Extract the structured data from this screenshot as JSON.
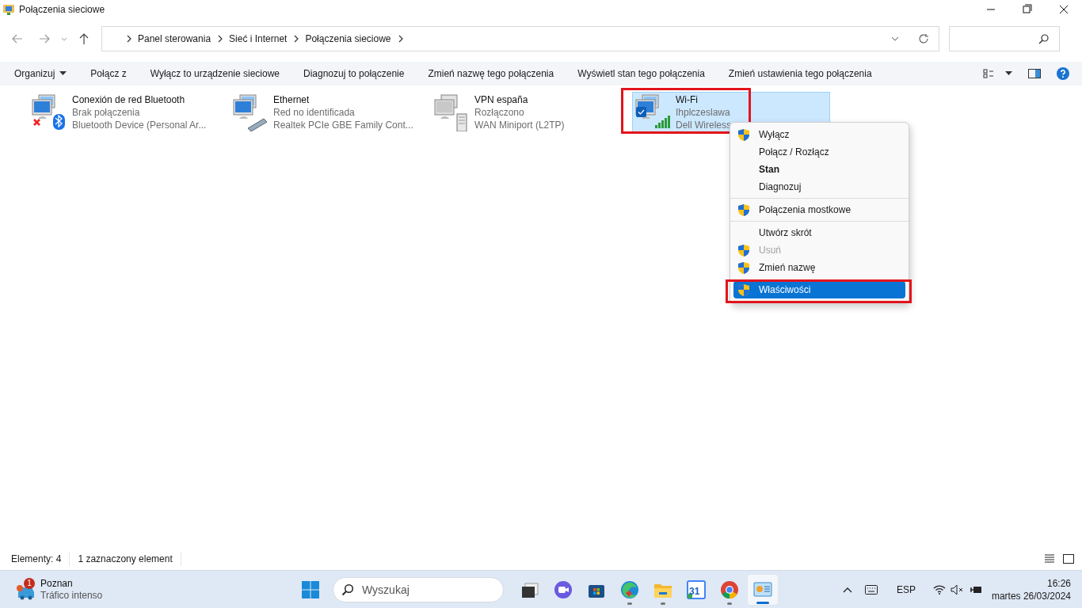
{
  "window": {
    "title": "Połączenia sieciowe"
  },
  "address": {
    "segments": [
      "Panel sterowania",
      "Sieć i Internet",
      "Połączenia sieciowe"
    ]
  },
  "toolbar": {
    "commands": [
      {
        "label": "Organizuj",
        "dropdown": true
      },
      {
        "label": "Połącz z",
        "dropdown": false
      },
      {
        "label": "Wyłącz to urządzenie sieciowe",
        "dropdown": false
      },
      {
        "label": "Diagnozuj to połączenie",
        "dropdown": false
      },
      {
        "label": "Zmień nazwę tego połączenia",
        "dropdown": false
      },
      {
        "label": "Wyświetl stan tego połączenia",
        "dropdown": false
      },
      {
        "label": "Zmień ustawienia tego połączenia",
        "dropdown": false
      }
    ]
  },
  "connections": [
    {
      "kind": "bluetooth",
      "name": "Conexión de red Bluetooth",
      "status": "Brak połączenia",
      "device": "Bluetooth Device (Personal Ar...",
      "selected": false
    },
    {
      "kind": "ethernet",
      "name": "Ethernet",
      "status": "Red no identificada",
      "device": "Realtek PCIe GBE Family Cont...",
      "selected": false
    },
    {
      "kind": "vpn",
      "name": "VPN españa",
      "status": "Rozłączono",
      "device": "WAN Miniport (L2TP)",
      "selected": false
    },
    {
      "kind": "wifi",
      "name": "Wi-Fi",
      "status": "Ihplczeslawa",
      "device": "Dell Wireless",
      "selected": true
    }
  ],
  "context_menu": {
    "items": [
      {
        "kind": "shield",
        "label": "Wyłącz",
        "disabled": false,
        "selected": false
      },
      {
        "kind": "plain",
        "label": "Połącz / Rozłącz",
        "disabled": false,
        "selected": false
      },
      {
        "kind": "default",
        "label": "Stan",
        "disabled": false,
        "selected": false
      },
      {
        "kind": "plain",
        "label": "Diagnozuj",
        "disabled": false,
        "selected": false
      },
      {
        "kind": "separator"
      },
      {
        "kind": "shield",
        "label": "Połączenia mostkowe",
        "disabled": false,
        "selected": false
      },
      {
        "kind": "separator"
      },
      {
        "kind": "plain",
        "label": "Utwórz skrót",
        "disabled": false,
        "selected": false
      },
      {
        "kind": "shield",
        "label": "Usuń",
        "disabled": true,
        "selected": false
      },
      {
        "kind": "shield",
        "label": "Zmień nazwę",
        "disabled": false,
        "selected": false
      },
      {
        "kind": "shield",
        "label": "Właściwości",
        "disabled": false,
        "selected": true
      }
    ]
  },
  "status_bar": {
    "items": [
      "Elementy: 4",
      "1 zaznaczony element"
    ]
  },
  "taskbar": {
    "weather": {
      "badge": "1",
      "city": "Poznan",
      "condition": "Tráfico intenso"
    },
    "search": {
      "placeholder": "Wyszukaj"
    },
    "apps": [
      {
        "kind": "taskview",
        "running": false,
        "active": false
      },
      {
        "kind": "meet",
        "running": false,
        "active": false
      },
      {
        "kind": "store",
        "running": false,
        "active": false
      },
      {
        "kind": "edge",
        "running": true,
        "active": false
      },
      {
        "kind": "explorer",
        "running": true,
        "active": false
      },
      {
        "kind": "calendar",
        "label": "31",
        "running": false,
        "active": false
      },
      {
        "kind": "chrome",
        "running": true,
        "active": false
      },
      {
        "kind": "controlpanel",
        "running": true,
        "active": true
      }
    ],
    "language": "ESP",
    "time": "16:26",
    "date": "martes 26/03/2024"
  }
}
